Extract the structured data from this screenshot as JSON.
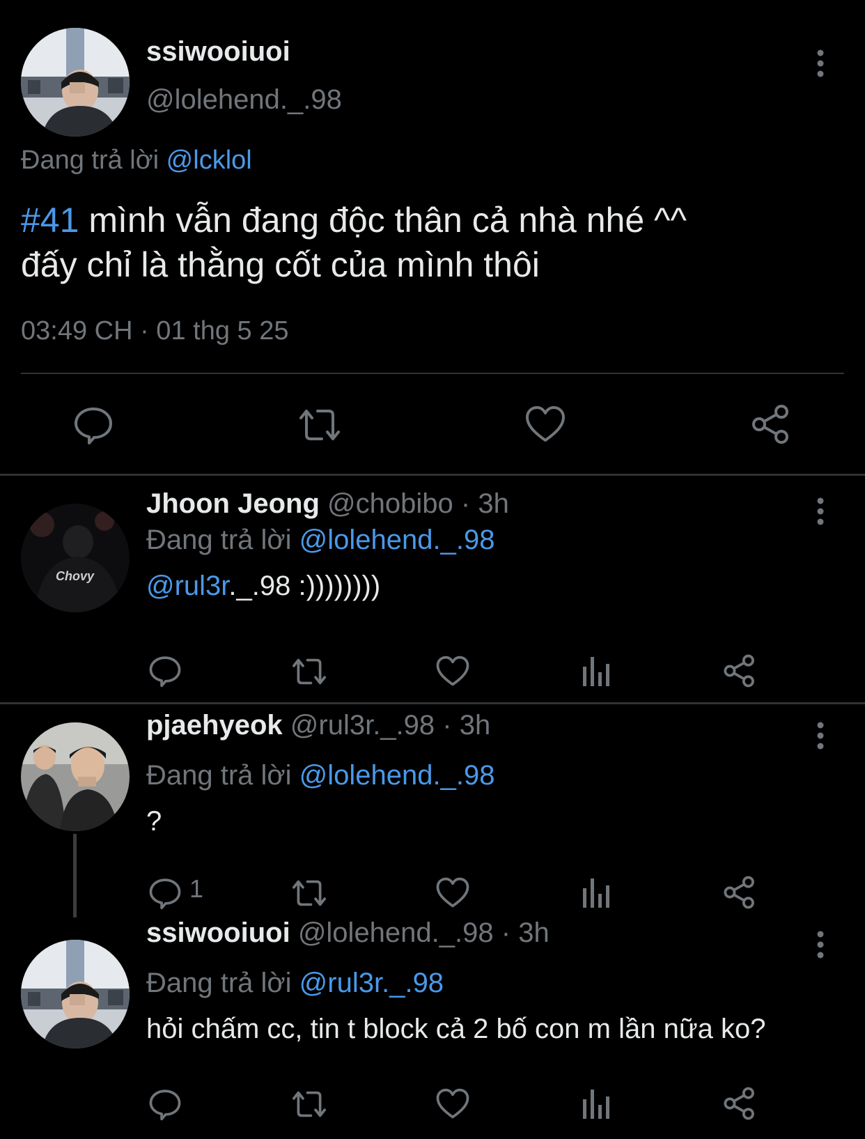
{
  "main_tweet": {
    "display_name": "ssiwooiuoi",
    "handle": "@lolehend._.98",
    "replying_prefix": "Đang trả lời",
    "replying_to": "@lcklol",
    "hashtag": "#41",
    "text_line1": " mình vẫn đang độc thân cả nhà nhé ^^",
    "text_line2": "đấy chỉ là thằng cốt của mình thôi",
    "timestamp": "03:49 CH · 01 thg 5 25"
  },
  "replies": [
    {
      "display_name": "Jhoon Jeong",
      "handle": "@chobibo",
      "time": "3h",
      "replying_prefix": "Đang trả lời",
      "replying_to": "@lolehend._.98",
      "mention": "@rul3r",
      "text": "._.98 :))))))))",
      "reply_count": ""
    },
    {
      "display_name": "pjaehyeok",
      "handle": "@rul3r._.98",
      "time": "3h",
      "replying_prefix": "Đang trả lời",
      "replying_to": "@lolehend._.98",
      "mention": "",
      "text": "?",
      "reply_count": "1"
    },
    {
      "display_name": "ssiwooiuoi",
      "handle": "@lolehend._.98",
      "time": "3h",
      "replying_prefix": "Đang trả lời",
      "replying_to": "@rul3r._.98",
      "mention": "",
      "text": "hỏi chấm cc, tin t block cả 2 bố con m lần nữa ko?",
      "reply_count": ""
    }
  ],
  "separator": "·",
  "icons": {
    "reply": "reply-bubble-icon",
    "retweet": "retweet-icon",
    "like": "heart-icon",
    "views": "views-bar-chart-icon",
    "share": "share-icon",
    "more": "more-vertical-icon"
  },
  "colors": {
    "background": "#000000",
    "text": "#e7e9ea",
    "muted": "#71767b",
    "link": "#4a99e9",
    "divider": "#2f3336"
  }
}
